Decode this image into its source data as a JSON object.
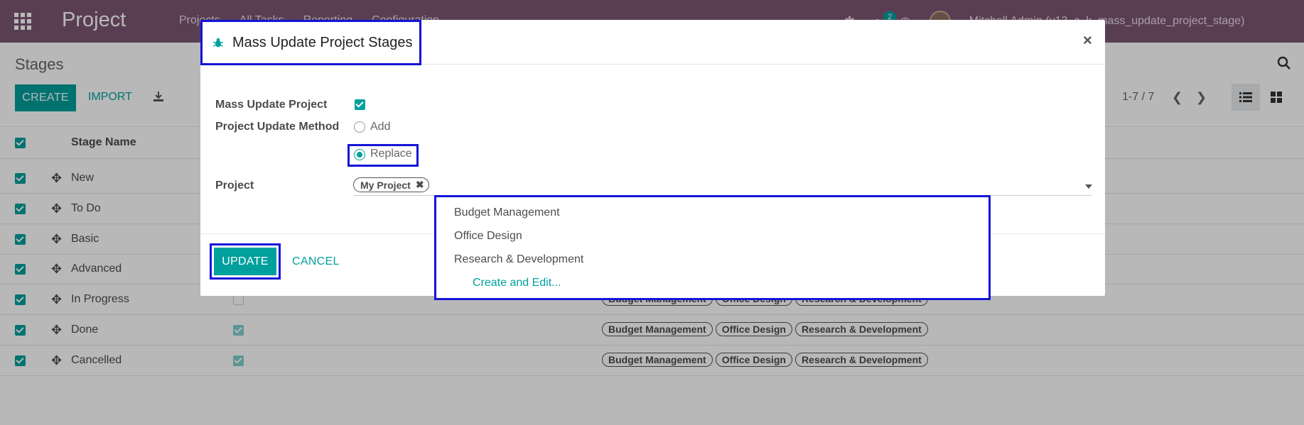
{
  "navbar": {
    "app_name": "Project",
    "menu": [
      "Projects",
      "All Tasks",
      "Reporting",
      "Configuration"
    ],
    "chat_badge": "2",
    "user": "Mitchell Admin (v13_c_k_mass_update_project_stage)"
  },
  "control": {
    "title": "Stages",
    "create_label": "CREATE",
    "import_label": "IMPORT",
    "pager": "1-7 / 7"
  },
  "list": {
    "column_stage_name": "Stage Name",
    "rows": [
      {
        "name": "New"
      },
      {
        "name": "To Do"
      },
      {
        "name": "Basic"
      },
      {
        "name": "Advanced"
      },
      {
        "name": "In Progress"
      },
      {
        "name": "Done"
      },
      {
        "name": "Cancelled"
      }
    ],
    "project_tags": [
      "Budget Management",
      "Office Design",
      "Research & Development"
    ]
  },
  "modal": {
    "title": "Mass Update Project Stages",
    "close": "×",
    "mass_update_label": "Mass Update Project",
    "method_label": "Project Update Method",
    "method_options": [
      "Add",
      "Replace"
    ],
    "method_selected": "Replace",
    "project_label": "Project",
    "project_selected_tag": "My Project",
    "dropdown_items": [
      "Budget Management",
      "Office Design",
      "Research & Development"
    ],
    "dropdown_create": "Create and Edit...",
    "update_label": "UPDATE",
    "cancel_label": "CANCEL"
  },
  "colors": {
    "navbar": "#7c5673",
    "primary": "#00a09d",
    "highlight_border": "#1414d6"
  },
  "icons": [
    "apps-icon",
    "bug-icon",
    "chat-icon",
    "clock-icon",
    "search-icon",
    "download-icon",
    "drag-handle-icon",
    "list-view-icon",
    "kanban-view-icon",
    "close-icon"
  ]
}
